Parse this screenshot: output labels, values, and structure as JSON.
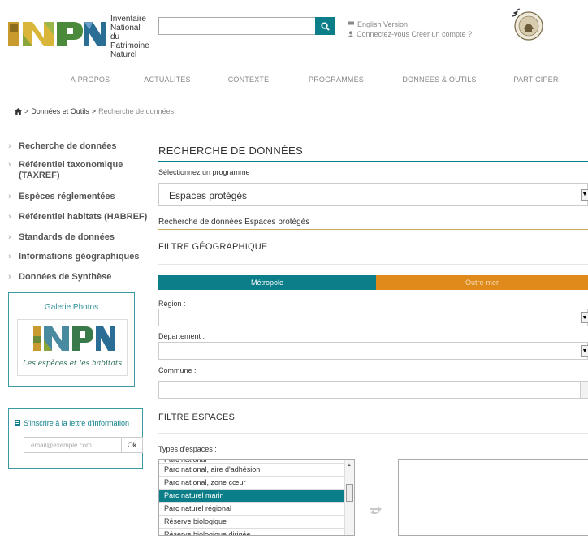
{
  "header": {
    "org_line1": "Inventaire",
    "org_line2": "National du",
    "org_line3": "Patrimoine",
    "org_line4": "Naturel",
    "search_placeholder": "",
    "english_link": "English Version",
    "account_link": "Connectez-vous Créer un compte ?"
  },
  "nav": [
    "À PROPOS",
    "ACTUALITÉS",
    "CONTEXTE",
    "PROGRAMMES",
    "DONNÉES & OUTILS",
    "PARTICIPER"
  ],
  "breadcrumb": {
    "sep1": ">",
    "item1": "Données et Outils",
    "sep2": ">",
    "current": "Recherche de données"
  },
  "sidebar": {
    "items": [
      {
        "label": "Recherche de données"
      },
      {
        "label": "Référentiel taxonomique (TAXREF)"
      },
      {
        "label": "Espèces réglementées"
      },
      {
        "label": "Référentiel habitats (HABREF)"
      },
      {
        "label": "Standards de données"
      },
      {
        "label": "Informations géographiques"
      },
      {
        "label": "Données de Synthèse"
      }
    ],
    "gallery_title": "Galerie Photos",
    "gallery_tagline": "Les espèces et les habitats",
    "newsletter_title": "S'inscrire à la lettre d'information",
    "newsletter_placeholder": "email@exemple.com",
    "newsletter_button": "Ok"
  },
  "main": {
    "title": "RECHERCHE DE DONNÉES",
    "program_label": "Sélectionnez un programme",
    "program_value": "Espaces protégés",
    "subtitle": "Recherche de données Espaces protégés",
    "geo_title": "FILTRE GÉOGRAPHIQUE",
    "tab_metropole": "Métropole",
    "tab_outremer": "Outre-mer",
    "region_label": "Région :",
    "departement_label": "Département :",
    "commune_label": "Commune :",
    "espaces_title": "FILTRE ESPACES",
    "types_label": "Types d'espaces :",
    "types_options": [
      {
        "label": "Parc national",
        "selected": false
      },
      {
        "label": "Parc national, aire d'adhésion",
        "selected": false
      },
      {
        "label": "Parc national, zone cœur",
        "selected": false
      },
      {
        "label": "Parc naturel marin",
        "selected": true
      },
      {
        "label": "Parc naturel régional",
        "selected": false
      },
      {
        "label": "Réserve biologique",
        "selected": false
      },
      {
        "label": "Réserve biologique dirigée",
        "selected": false
      }
    ]
  },
  "colors": {
    "teal": "#0b7e89",
    "orange": "#e08a1c",
    "gold_rule": "#c9a95a"
  }
}
